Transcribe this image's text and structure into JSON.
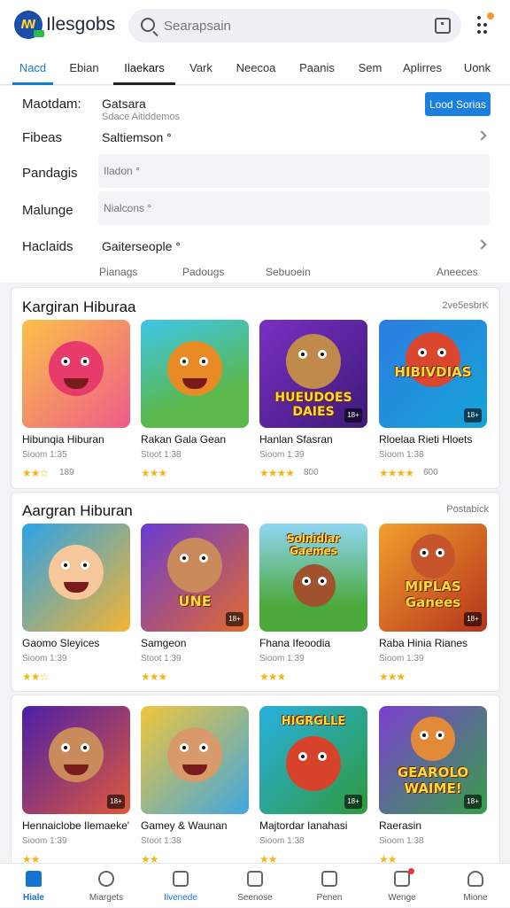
{
  "header": {
    "logo_text": "ꟿ",
    "brand": "Ilesgobs",
    "search_placeholder": "Searapsain"
  },
  "tabs": [
    {
      "label": "Nacd"
    },
    {
      "label": "Ebian"
    },
    {
      "label": "Ilaekars"
    },
    {
      "label": "Vark"
    },
    {
      "label": "Neecoa"
    },
    {
      "label": "Paanis"
    },
    {
      "label": "Sem"
    },
    {
      "label": "Aplirres"
    },
    {
      "label": "Uonk"
    }
  ],
  "filters": {
    "row1": {
      "label": "Maotdam:",
      "value": "Gatsara",
      "sub": "Sdace Aitiddemos",
      "button": "Lood Sorias"
    },
    "row2": {
      "label": "Fibeas",
      "value": "Saltiemson ᐤ"
    },
    "row3": {
      "label": "Pandagis",
      "box": "Iladon ᐤ"
    },
    "row4": {
      "label": "Malunge",
      "box": "Nialcons ᐤ"
    },
    "row5": {
      "label": "Haclaids",
      "value": "Gaiterseople ᐤ"
    },
    "sort": [
      "Pianags",
      "Padougs",
      "Sebuoein",
      "Aneeces"
    ]
  },
  "sections": [
    {
      "title": "Kargiran Hiburaa",
      "more": "2ve5esbrK",
      "cards": [
        {
          "title": "Hibunqia Hiburan",
          "meta": "Sioom 1:35",
          "stars": "★★☆",
          "count": "189",
          "banner": "",
          "age": ""
        },
        {
          "title": "Rakan Gala Gean",
          "meta": "Stoot 1:38",
          "stars": "★★★",
          "count": "",
          "banner": "",
          "age": ""
        },
        {
          "title": "Hanlan Sfasran",
          "meta": "Sioom 1:39",
          "stars": "★★★★",
          "count": "800",
          "banner": "HUEUDOES DAIES",
          "age": "18+"
        },
        {
          "title": "Rloelaa Rieti Hloets",
          "meta": "Sioom 1:38",
          "stars": "★★★★",
          "count": "600",
          "banner": "HIBIVDIAS",
          "age": "18+"
        }
      ]
    },
    {
      "title": "Aargran Hiburan",
      "more": "Postabick",
      "cards": [
        {
          "title": "Gaomo Sleyices",
          "meta": "Sioom 1:39",
          "stars": "★★☆",
          "count": "",
          "banner": "",
          "age": ""
        },
        {
          "title": "Samgeon",
          "meta": "Stoot 1:39",
          "stars": "★★★",
          "count": "",
          "banner": "UNE",
          "age": "18+"
        },
        {
          "title": "Fhana Ifeoodia",
          "meta": "Sioom 1:39",
          "stars": "★★★",
          "count": "",
          "banner": "Solnidlar Gaemes",
          "age": ""
        },
        {
          "title": "Raba Hinia Rianes",
          "meta": "Sioom 1:39",
          "stars": "★★★",
          "count": "",
          "banner": "MIPLAS Ganees",
          "age": "18+"
        }
      ]
    },
    {
      "title": "",
      "more": "",
      "cards": [
        {
          "title": "Hennaiclobe Ilemaeke'",
          "meta": "Sioom 1:39",
          "stars": "★★",
          "count": "",
          "banner": "",
          "age": "18+"
        },
        {
          "title": "Gamey & Waunan",
          "meta": "Stoot 1:38",
          "stars": "★★",
          "count": "",
          "banner": "",
          "age": ""
        },
        {
          "title": "Majtordar Ianahasi",
          "meta": "Sioom 1:38",
          "stars": "★★",
          "count": "",
          "banner": "HIGRGLLE",
          "age": "18+"
        },
        {
          "title": "Raerasin",
          "meta": "Sioom 1:38",
          "stars": "★★",
          "count": "",
          "banner": "GEAROLO WAIME!",
          "age": "18+"
        }
      ]
    }
  ],
  "bottom_nav": [
    {
      "label": "Hiale",
      "icon": "home-icon"
    },
    {
      "label": "Miargets",
      "icon": "compass-icon"
    },
    {
      "label": "Ilvenede",
      "icon": "book-icon"
    },
    {
      "label": "Seenose",
      "icon": "edit-icon"
    },
    {
      "label": "Penen",
      "icon": "chart-icon"
    },
    {
      "label": "Wenge",
      "icon": "bell-icon"
    },
    {
      "label": "Mione",
      "icon": "person-icon"
    }
  ],
  "colors": {
    "accent": "#1b7fde",
    "star": "#f2b61c"
  }
}
